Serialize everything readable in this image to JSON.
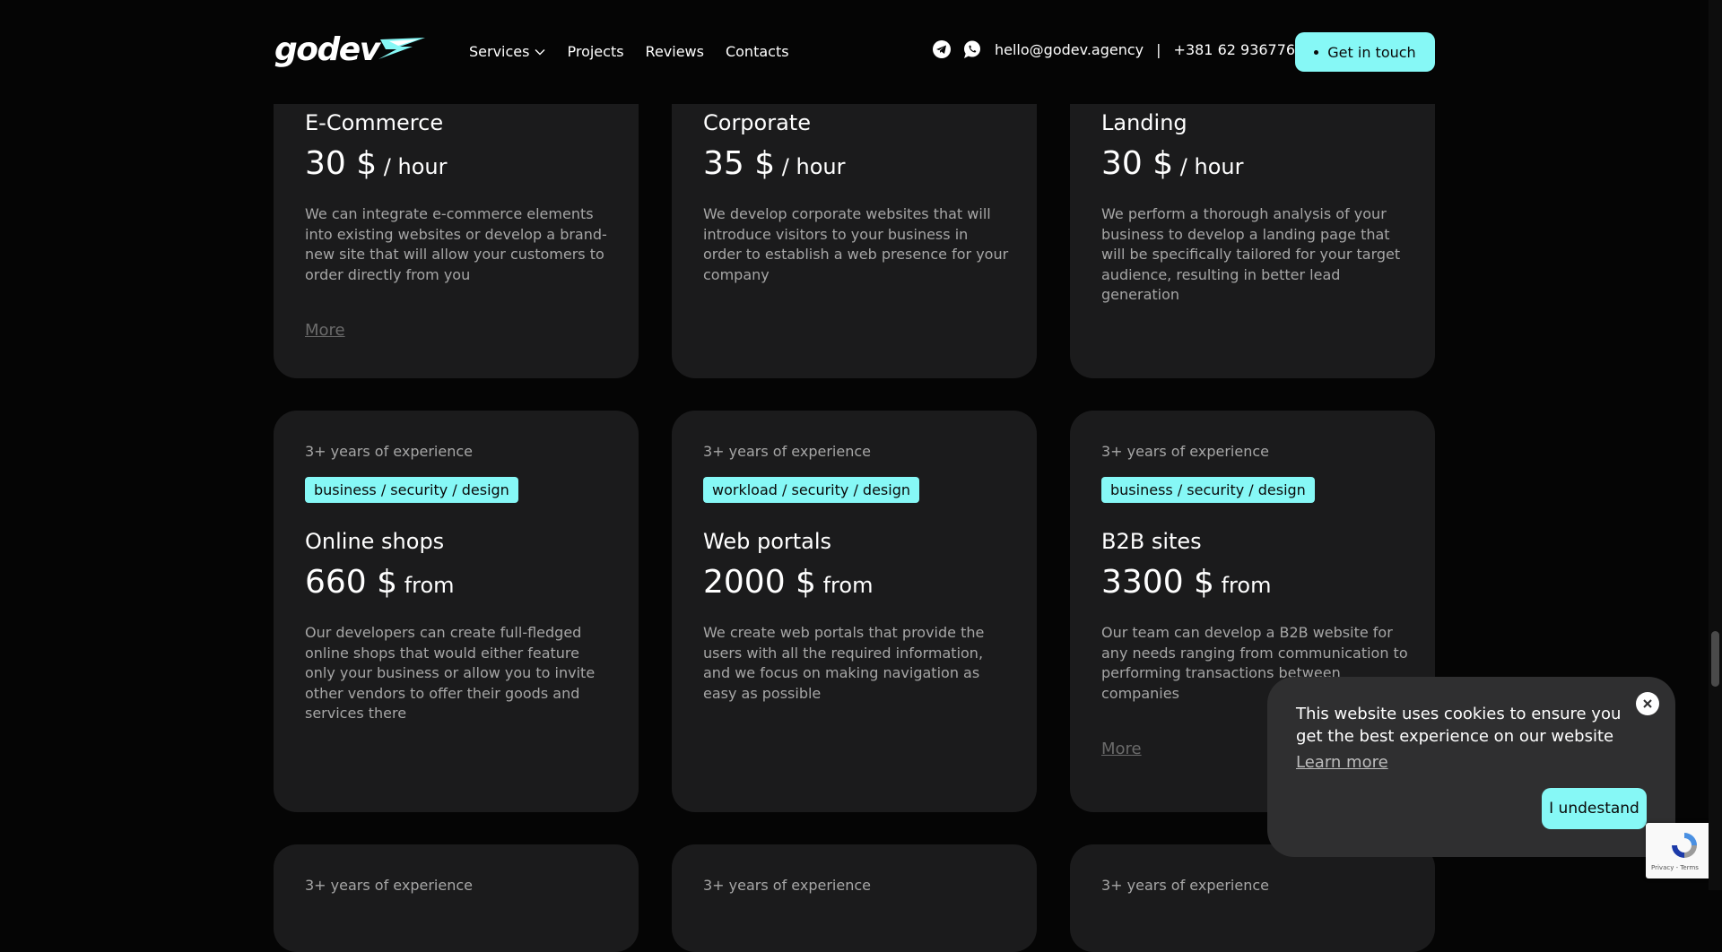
{
  "header": {
    "logo": "godev",
    "nav": [
      {
        "label": "Services",
        "dropdown": true
      },
      {
        "label": "Projects"
      },
      {
        "label": "Reviews"
      },
      {
        "label": "Contacts"
      }
    ],
    "email": "hello@godev.agency",
    "separator": "|",
    "phone": "+381 62 9367761",
    "cta": "Get in touch",
    "icons": [
      "telegram-icon",
      "whatsapp-icon"
    ]
  },
  "cards_row1": [
    {
      "title": "E-Commerce",
      "price": "30 $",
      "unit": " / hour",
      "desc": "We can integrate e-commerce elements into existing websites or develop a brand-new site that will allow your customers to order directly from you",
      "more": "More"
    },
    {
      "title": "Corporate",
      "price": "35 $",
      "unit": " / hour",
      "desc": "We develop corporate websites that will introduce visitors to your business in order to establish a web presence for your company",
      "more": ""
    },
    {
      "title": "Landing",
      "price": "30 $",
      "unit": " / hour",
      "desc": "We perform a thorough analysis of your business to develop a landing page that will be specifically tailored for your target audience, resulting in better lead generation",
      "more": ""
    }
  ],
  "cards_row2": [
    {
      "experience": "3+ years of experience",
      "tag": "business / security / design",
      "title": "Online shops",
      "price": "660 $",
      "unit": " from",
      "desc": "Our developers can create full-fledged online shops that would either feature only your business or allow you to invite other vendors to offer their goods and services there",
      "more": ""
    },
    {
      "experience": "3+ years of experience",
      "tag": "workload / security / design",
      "title": "Web portals",
      "price": "2000 $",
      "unit": " from",
      "desc": "We create web portals that provide the users with all the required information, and we focus on making navigation as easy as possible",
      "more": ""
    },
    {
      "experience": "3+ years of experience",
      "tag": "business / security / design",
      "title": "B2B sites",
      "price": "3300 $",
      "unit": " from",
      "desc": "Our team can develop a B2B website for any needs ranging from communication to performing transactions between companies",
      "more": "More"
    }
  ],
  "cards_row3": [
    {
      "experience": "3+ years of experience"
    },
    {
      "experience": "3+ years of experience"
    },
    {
      "experience": "3+ years of experience"
    }
  ],
  "cookie": {
    "text": "This website uses cookies to ensure you get the best experience on our website",
    "link": "Learn more",
    "button": "I undestand",
    "close": "✕"
  },
  "recaptcha": {
    "text": "Privacy - Terms"
  },
  "colors": {
    "accent": "#86f8f6",
    "background": "#050505",
    "card": "#1b1b1c"
  }
}
